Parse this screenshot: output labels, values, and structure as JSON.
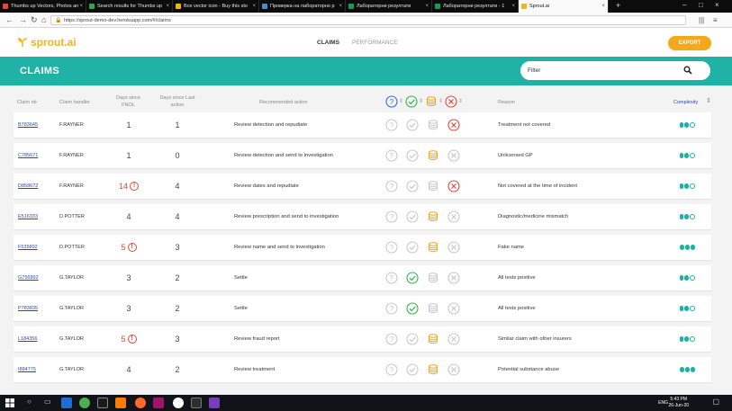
{
  "browser": {
    "tabs": [
      {
        "title": "Thumbs up Vectors, Photos an",
        "color": "#e0473d"
      },
      {
        "title": "Search results for Thumbs up",
        "color": "#2ea44f"
      },
      {
        "title": "Box vector icon - Buy this sto",
        "color": "#f4b400"
      },
      {
        "title": "Проверка на лабораторно р",
        "color": "#4a8bd6"
      },
      {
        "title": "Лабораторни резултати",
        "color": "#0f9d58"
      },
      {
        "title": "Лабораторни резултати - 1",
        "color": "#0f9d58"
      },
      {
        "title": "Sprout.ai",
        "color": "#f5b31b"
      }
    ],
    "url": "https://sprout-demo-dev.herokuapp.com/#/claims"
  },
  "app": {
    "logo_text": "sprout.ai",
    "nav_claims": "CLAIMS",
    "nav_performance": "PERFORMANCE",
    "export_label": "EXPORT",
    "page_title": "CLAIMS",
    "filter_placeholder": "Filter"
  },
  "table": {
    "headers": {
      "claim_id": "Claim nb",
      "handler": "Claim handler",
      "days_fnol": "Days since FNOL",
      "days_last": "Days since Last action",
      "action": "Recommended action",
      "reason": "Reason",
      "complexity": "Complexity"
    },
    "rows": [
      {
        "id": "B783645",
        "handler": "F.RAYNER",
        "fnol": "1",
        "fnol_alert": false,
        "last": "1",
        "action": "Review detection and repudiate",
        "status": "reject",
        "reason": "Treatment not covered",
        "complexity": 2
      },
      {
        "id": "C785671",
        "handler": "F.RAYNER",
        "fnol": "1",
        "fnol_alert": false,
        "last": "0",
        "action": "Review detection and send to investigation",
        "status": "investigate",
        "reason": "Unlicensed GP",
        "complexity": 2
      },
      {
        "id": "D858672",
        "handler": "F.RAYNER",
        "fnol": "14",
        "fnol_alert": true,
        "last": "4",
        "action": "Review dates and repudiate",
        "status": "reject",
        "reason": "Not covered at the time of incident",
        "complexity": 2
      },
      {
        "id": "E516333",
        "handler": "D.POTTER",
        "fnol": "4",
        "fnol_alert": false,
        "last": "4",
        "action": "Review prescription and send to investigation",
        "status": "investigate",
        "reason": "Diagnostic/medicine mismatch",
        "complexity": 2
      },
      {
        "id": "F535892",
        "handler": "D.POTTER",
        "fnol": "5",
        "fnol_alert": true,
        "last": "3",
        "action": "Review name and send to investigation",
        "status": "investigate",
        "reason": "Fake name",
        "complexity": 3
      },
      {
        "id": "G756892",
        "handler": "G.TAYLOR",
        "fnol": "3",
        "fnol_alert": false,
        "last": "2",
        "action": "Settle",
        "status": "approve",
        "reason": "All tests positive",
        "complexity": 2
      },
      {
        "id": "P783835",
        "handler": "G.TAYLOR",
        "fnol": "3",
        "fnol_alert": false,
        "last": "2",
        "action": "Settle",
        "status": "approve",
        "reason": "All tests positive",
        "complexity": 2
      },
      {
        "id": "L184356",
        "handler": "G.TAYLOR",
        "fnol": "5",
        "fnol_alert": true,
        "last": "3",
        "action": "Review fraud report",
        "status": "investigate",
        "reason": "Similar claim with other insurers",
        "complexity": 2
      },
      {
        "id": "I884775",
        "handler": "G.TAYLOR",
        "fnol": "4",
        "fnol_alert": false,
        "last": "2",
        "action": "Review treatment",
        "status": "investigate",
        "reason": "Potential substance abuse",
        "complexity": 3
      }
    ]
  },
  "taskbar": {
    "lang": "ENG",
    "time": "5:43 PM",
    "date": "26-Jun-20"
  },
  "colors": {
    "teal": "#20b2a6",
    "orange": "#f6a71b",
    "green": "#2db84b",
    "red": "#e04b3a",
    "blue": "#2c6fd1"
  }
}
